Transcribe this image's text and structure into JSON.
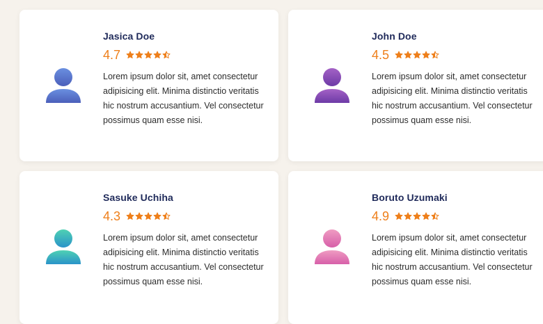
{
  "colors": {
    "page_background": "#f6f2ec",
    "card_background": "#ffffff",
    "name_text": "#1f2a5a",
    "rating_text": "#ee7f1a",
    "star_fill": "#ee7f1a"
  },
  "reviews": [
    {
      "name": "Jasica Doe",
      "rating": "4.7",
      "stars": 4.5,
      "text": "Lorem ipsum dolor sit, amet consectetur adipisicing elit. Minima distinctio veritatis hic nostrum accusantium. Vel consectetur possimus quam esse nisi.",
      "avatar_icon": "user-icon",
      "avatar_gradient": [
        "#6a8fe0",
        "#4b5fba"
      ]
    },
    {
      "name": "John Doe",
      "rating": "4.5",
      "stars": 4.5,
      "text": "Lorem ipsum dolor sit, amet consectetur adipisicing elit. Minima distinctio veritatis hic nostrum accusantium. Vel consectetur possimus quam esse nisi.",
      "avatar_icon": "user-icon",
      "avatar_gradient": [
        "#a462c6",
        "#6d3aa6"
      ]
    },
    {
      "name": "Sasuke Uchiha",
      "rating": "4.3",
      "stars": 4.5,
      "text": "Lorem ipsum dolor sit, amet consectetur adipisicing elit. Minima distinctio veritatis hic nostrum accusantium. Vel consectetur possimus quam esse nisi.",
      "avatar_icon": "user-icon",
      "avatar_gradient": [
        "#4fd1b3",
        "#2a93c9"
      ]
    },
    {
      "name": "Boruto Uzumaki",
      "rating": "4.9",
      "stars": 4.5,
      "text": "Lorem ipsum dolor sit, amet consectetur adipisicing elit. Minima distinctio veritatis hic nostrum accusantium. Vel consectetur possimus quam esse nisi.",
      "avatar_icon": "user-icon",
      "avatar_gradient": [
        "#ef9cc2",
        "#d75fa9"
      ]
    }
  ]
}
